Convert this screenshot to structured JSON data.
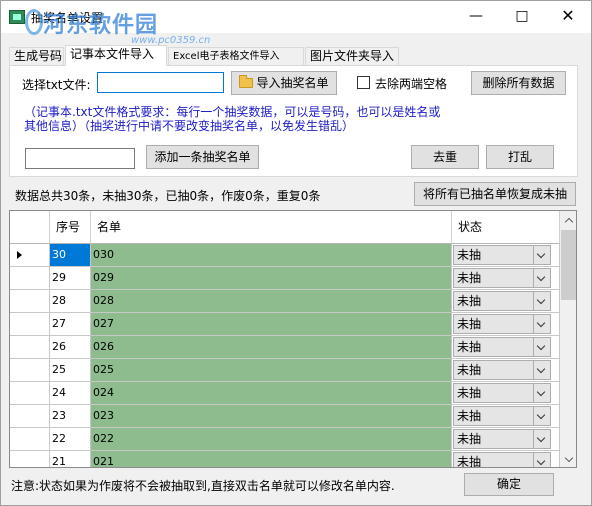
{
  "window": {
    "title": "抽奖名单设置",
    "minimize_icon": "minimize-icon",
    "maximize_icon": "maximize-icon",
    "close_icon": "close-icon"
  },
  "watermark": {
    "main": "河东软件园",
    "sub": "www.pc0359.cn"
  },
  "tabs": [
    {
      "label": "生成号码",
      "active": false
    },
    {
      "label": "记事本文件导入",
      "active": true
    },
    {
      "label": "Excel电子表格文件导入",
      "active": false
    },
    {
      "label": "图片文件夹导入",
      "active": false
    }
  ],
  "txt_import": {
    "file_label": "选择txt文件:",
    "file_value": "",
    "import_button": "导入抽奖名单",
    "import_icon": "folder-icon",
    "trim_checkbox_label": "去除两端空格",
    "trim_checked": false,
    "delete_all_button": "删除所有数据",
    "note_line1": "（记事本.txt文件格式要求：每行一个抽奖数据，可以是号码，也可以是姓名或",
    "note_line2": "其他信息）（抽奖进行中请不要改变抽奖名单，以免发生错乱）",
    "add_input_value": "",
    "add_button": "添加一条抽奖名单",
    "dedupe_button": "去重",
    "shuffle_button": "打乱"
  },
  "stats": {
    "text": "数据总共30条，未抽30条，已抽0条，作废0条，重复0条",
    "restore_button": "将所有已抽名单恢复成未抽"
  },
  "grid": {
    "columns": [
      "序号",
      "名单",
      "状态"
    ],
    "rows": [
      {
        "id": "30",
        "name": "030",
        "status": "未抽"
      },
      {
        "id": "29",
        "name": "029",
        "status": "未抽"
      },
      {
        "id": "28",
        "name": "028",
        "status": "未抽"
      },
      {
        "id": "27",
        "name": "027",
        "status": "未抽"
      },
      {
        "id": "26",
        "name": "026",
        "status": "未抽"
      },
      {
        "id": "25",
        "name": "025",
        "status": "未抽"
      },
      {
        "id": "24",
        "name": "024",
        "status": "未抽"
      },
      {
        "id": "23",
        "name": "023",
        "status": "未抽"
      },
      {
        "id": "22",
        "name": "022",
        "status": "未抽"
      },
      {
        "id": "21",
        "name": "021",
        "status": "未抽"
      }
    ],
    "selected_row": 0,
    "name_cell_color": "#8fbc8f"
  },
  "footer": {
    "note": "注意:状态如果为作废将不会被抽取到,直接双击名单就可以修改名单内容.",
    "ok_button": "确定"
  }
}
